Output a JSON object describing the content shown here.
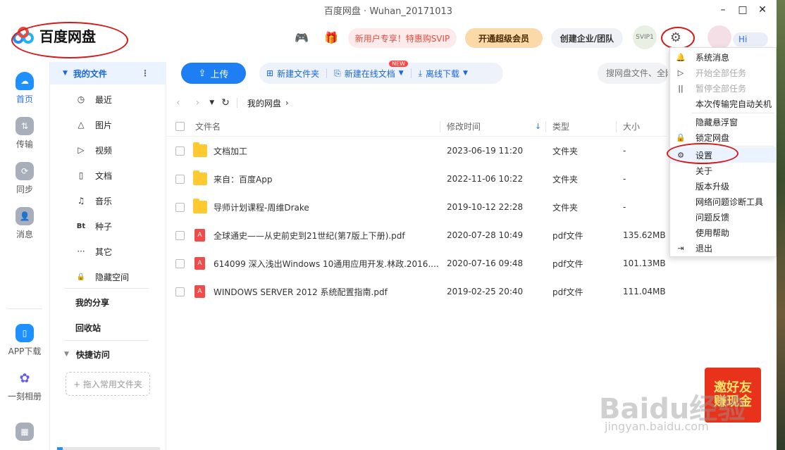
{
  "window": {
    "title": "百度网盘 · Wuhan_20171013",
    "controls": [
      "–",
      "□",
      "✕"
    ]
  },
  "header": {
    "logo_text": "百度网盘",
    "svip_promo": "新用户专享！特惠购SVIP",
    "vip_button": "开通超级会员",
    "team_button": "创建企业/团队",
    "svip_badge": "SVIP1",
    "hi_label": "Hi",
    "game_icon": "gamepad-icon",
    "gift_icon": "gift-icon"
  },
  "leftnav": [
    {
      "label": "首页",
      "icon": "☁",
      "active": true
    },
    {
      "label": "传输",
      "icon": "⇅"
    },
    {
      "label": "同步",
      "icon": "⟳"
    },
    {
      "label": "消息",
      "icon": "👤"
    },
    {
      "label": "APP下载",
      "icon": "▯"
    },
    {
      "label": "一刻相册",
      "icon": "✿"
    }
  ],
  "sidebar": {
    "my_files": "我的文件",
    "items": [
      {
        "label": "最近",
        "icon": "◷"
      },
      {
        "label": "图片",
        "icon": "△"
      },
      {
        "label": "视频",
        "icon": "▷"
      },
      {
        "label": "文档",
        "icon": "▯"
      },
      {
        "label": "音乐",
        "icon": "♫"
      },
      {
        "label": "种子",
        "icon": "Bt"
      },
      {
        "label": "其它",
        "icon": "···"
      },
      {
        "label": "隐藏空间",
        "icon": "🔒"
      }
    ],
    "my_share": "我的分享",
    "recycle": "回收站",
    "quick_access": "快捷访问",
    "drop_hint": "+ 拖入常用文件夹"
  },
  "toolbar": {
    "upload": "上传",
    "new_folder": "新建文件夹",
    "new_doc": "新建在线文档",
    "new_badge": "NEW",
    "offline": "离线下载",
    "search_placeholder": "搜网盘文件、全网"
  },
  "path": {
    "current": "我的网盘"
  },
  "table": {
    "headers": {
      "name": "文件名",
      "date": "修改时间",
      "type": "类型",
      "size": "大小"
    },
    "rows": [
      {
        "kind": "folder",
        "name": "文档加工",
        "date": "2023-06-19 11:20",
        "type": "文件夹",
        "size": "-"
      },
      {
        "kind": "folder",
        "name": "来自：百度App",
        "date": "2022-11-06 10:22",
        "type": "文件夹",
        "size": "-"
      },
      {
        "kind": "folder",
        "name": "导师计划课程-周维Drake",
        "date": "2019-10-12 22:28",
        "type": "文件夹",
        "size": "-"
      },
      {
        "kind": "pdf",
        "name": "全球通史——从史前史到21世纪(第7版上下册).pdf",
        "date": "2020-07-28 10:49",
        "type": "pdf文件",
        "size": "135.62MB"
      },
      {
        "kind": "pdf",
        "name": "614099 深入浅出Windows 10通用应用开发.林政.2016....",
        "date": "2020-07-16 09:48",
        "type": "pdf文件",
        "size": "101.13MB"
      },
      {
        "kind": "pdf",
        "name": "WINDOWS SERVER 2012 系统配置指南.pdf",
        "date": "2019-02-25 20:40",
        "type": "pdf文件",
        "size": "111.04MB"
      }
    ]
  },
  "menu": [
    {
      "label": "系统消息",
      "icon": "🔔"
    },
    {
      "label": "开始全部任务",
      "icon": "▷",
      "disabled": true
    },
    {
      "label": "暂停全部任务",
      "icon": "||",
      "disabled": true
    },
    {
      "label": "本次传输完自动关机",
      "icon": ""
    },
    {
      "label": "隐藏悬浮窗",
      "icon": ""
    },
    {
      "label": "锁定网盘",
      "icon": "🔒"
    },
    {
      "label": "设置",
      "icon": "⚙",
      "highlight": true
    },
    {
      "label": "关于",
      "icon": ""
    },
    {
      "label": "版本升级",
      "icon": ""
    },
    {
      "label": "网络问题诊断工具",
      "icon": ""
    },
    {
      "label": "问题反馈",
      "icon": ""
    },
    {
      "label": "使用帮助",
      "icon": ""
    },
    {
      "label": "退出",
      "icon": "⇥"
    }
  ],
  "promo": {
    "line1": "邀好友",
    "line2": "赚现金"
  },
  "watermark": {
    "main": "Baidu经验",
    "sub": "jingyan.baidu.com"
  },
  "colors": {
    "accent": "#1e7ff5",
    "annotation": "#d41a1a"
  }
}
